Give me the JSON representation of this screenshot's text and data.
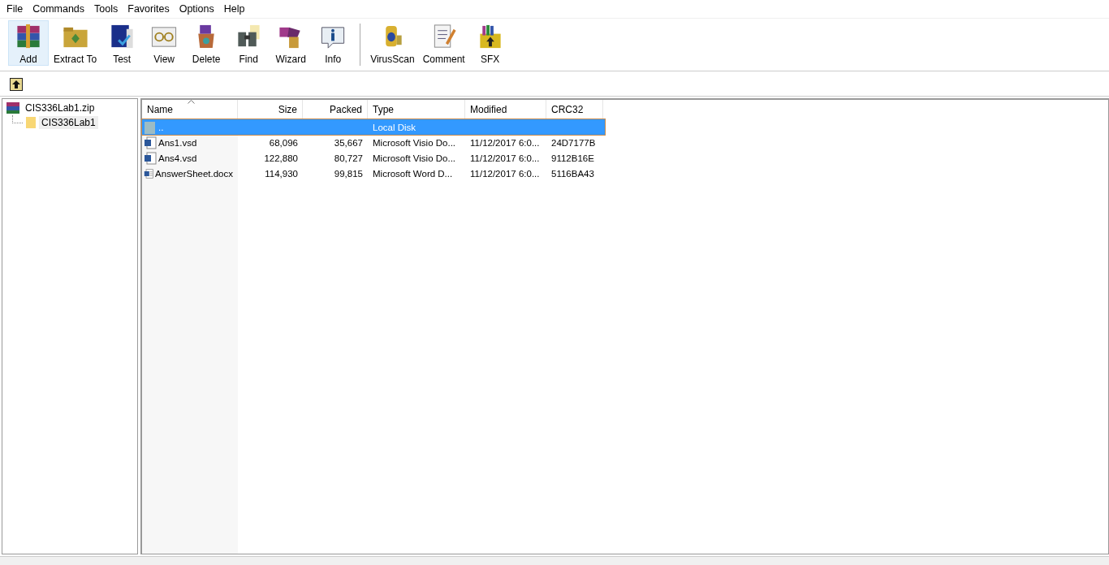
{
  "menu": [
    "File",
    "Commands",
    "Tools",
    "Favorites",
    "Options",
    "Help"
  ],
  "toolbar": [
    [
      {
        "label": "Add",
        "selected": true
      },
      {
        "label": "Extract To",
        "selected": false
      },
      {
        "label": "Test",
        "selected": false
      },
      {
        "label": "View",
        "selected": false
      },
      {
        "label": "Delete",
        "selected": false
      },
      {
        "label": "Find",
        "selected": false
      },
      {
        "label": "Wizard",
        "selected": false
      },
      {
        "label": "Info",
        "selected": false
      }
    ],
    [
      {
        "label": "VirusScan",
        "selected": false
      },
      {
        "label": "Comment",
        "selected": false
      },
      {
        "label": "SFX",
        "selected": false
      }
    ]
  ],
  "tree": {
    "label": "CIS336Lab1.zip",
    "children": [
      {
        "label": "CIS336Lab1",
        "selected": true
      }
    ]
  },
  "table": {
    "columns": [
      "Name",
      "Size",
      "Packed",
      "Type",
      "Modified",
      "CRC32"
    ],
    "rows": [
      {
        "kind": "parent",
        "selected": true,
        "cells": [
          "..",
          "",
          "",
          "Local Disk",
          "",
          ""
        ]
      },
      {
        "kind": "visio",
        "selected": false,
        "cells": [
          "Ans1.vsd",
          "68,096",
          "35,667",
          "Microsoft Visio Do...",
          "11/12/2017 6:0...",
          "24D7177B"
        ]
      },
      {
        "kind": "visio",
        "selected": false,
        "cells": [
          "Ans4.vsd",
          "122,880",
          "80,727",
          "Microsoft Visio Do...",
          "11/12/2017 6:0...",
          "9112B16E"
        ]
      },
      {
        "kind": "word",
        "selected": false,
        "cells": [
          "AnswerSheet.docx",
          "114,930",
          "99,815",
          "Microsoft Word D...",
          "11/12/2017 6:0...",
          "5116BA43"
        ]
      }
    ]
  }
}
